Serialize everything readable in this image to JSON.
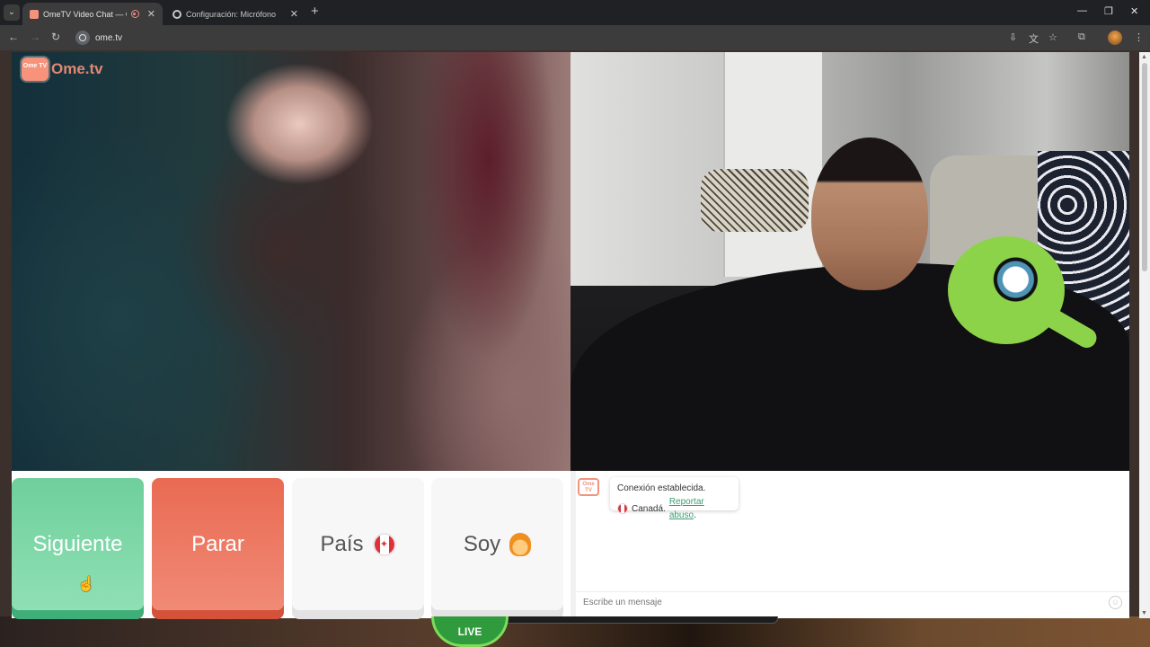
{
  "browser": {
    "tabs": [
      {
        "title": "OmeTV Video Chat — Omegle",
        "active": true
      },
      {
        "title": "Configuración: Micrófono",
        "active": false
      }
    ],
    "url": "ome.tv"
  },
  "site": {
    "logo_badge": "Ome TV",
    "logo_text": "Ome.tv"
  },
  "controls": {
    "next_label": "Siguiente",
    "stop_label": "Parar",
    "country_label": "País",
    "country_flag": "canada-flag-icon",
    "me_label": "Soy",
    "me_icon": "woman-emoji-icon"
  },
  "chat": {
    "status": "Conexión establecida.",
    "country": "Canadá.",
    "report_link": "Reportar abuso",
    "report_suffix": ".",
    "input_placeholder": "Escribe un mensaje"
  },
  "overlay": {
    "live_badge": "LIVE"
  },
  "colors": {
    "next_green": "#6fcf9c",
    "stop_red": "#ea6a52",
    "brand_coral": "#f3937d",
    "link_green": "#3a9e70"
  }
}
